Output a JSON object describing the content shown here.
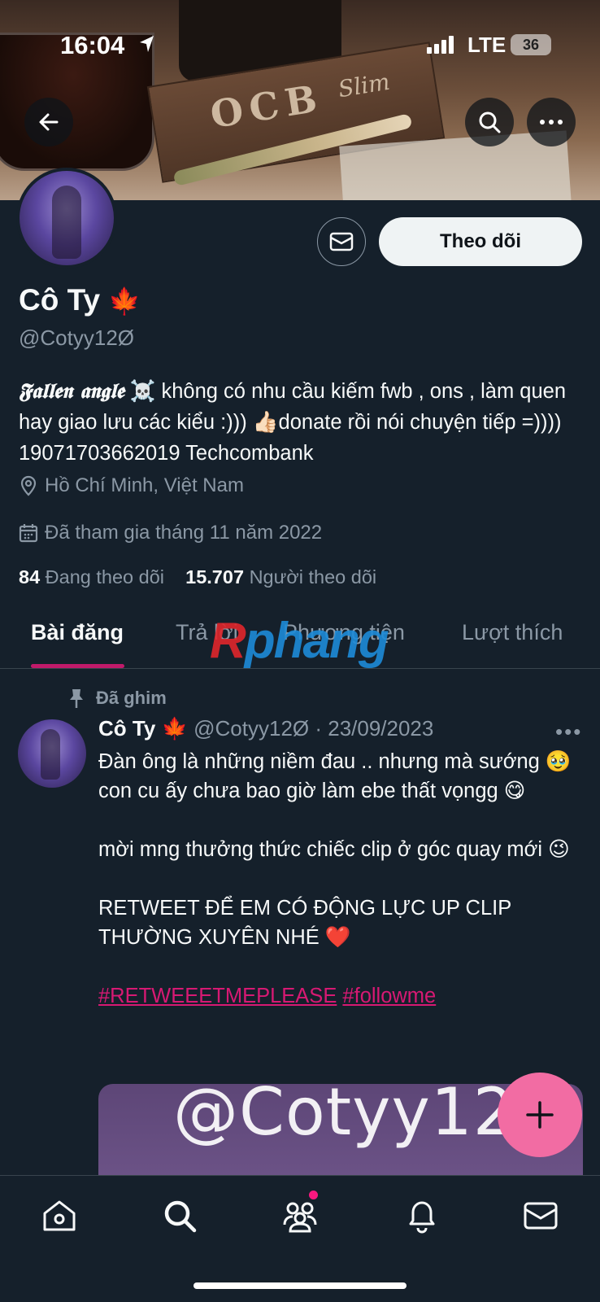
{
  "status_bar": {
    "time": "16:04",
    "network": "LTE",
    "battery": "36"
  },
  "profile": {
    "name": "Cô Ty",
    "name_emoji": "🍁",
    "handle": "@Cotyy12Ø",
    "follow_label": "Theo dõi",
    "bio_stylized": "𝕱𝖆𝖑𝖑𝖊𝖓 𝖆𝖓𝖌𝖑𝖊",
    "bio_skull": "☠️",
    "bio_line": "không có nhu cầu kiếm fwb , ons , làm quen hay giao lưu các kiểu :))) 👍🏻donate rồi nói chuyện tiếp =)))) 19071703662019 Techcombank",
    "location": "Hồ Chí Minh, Việt Nam",
    "joined": "Đã tham gia tháng 11 năm 2022",
    "following_count": "84",
    "following_label": "Đang theo dõi",
    "followers_count": "15.707",
    "followers_label": "Người theo dõi"
  },
  "tabs": [
    {
      "label": "Bài đăng",
      "active": true
    },
    {
      "label": "Trả lời",
      "active": false
    },
    {
      "label": "Phương tiện",
      "active": false
    },
    {
      "label": "Lượt thích",
      "active": false
    }
  ],
  "watermark": {
    "part1": "R",
    "part2": "phang"
  },
  "post": {
    "pinned_label": "Đã ghim",
    "author_name": "Cô Ty 🍁",
    "author_handle_date": "@Cotyy12Ø · 23/09/2023",
    "more": "•••",
    "line1": "Đàn ông là những niềm đau .. nhưng mà sướng 🥹 con cu ấy chưa bao giờ làm ebe thất vọngg 😋",
    "line2": " mời mng thưởng thức chiếc clip ở góc quay mới 😉",
    "line3": "RETWEET ĐỂ EM CÓ ĐỘNG LỰC UP CLIP THƯỜNG XUYÊN NHÉ ❤️",
    "hashtag1": "#RETWEEETMEPLEASE",
    "hashtag2": "#followme",
    "media_text": "@Cotyy120"
  },
  "colors": {
    "background": "#15202b",
    "accent_pink": "#f91880",
    "fab": "#f26ca3",
    "muted": "#8b98a5"
  },
  "icons": {
    "back": "back-arrow-icon",
    "search": "search-icon",
    "more": "more-icon",
    "message": "mail-icon",
    "location": "location-pin-icon",
    "calendar": "calendar-icon",
    "pin": "pin-icon",
    "compose": "plus-icon",
    "nav": [
      "home-icon",
      "search-icon",
      "communities-icon",
      "bell-icon",
      "mail-icon"
    ]
  }
}
